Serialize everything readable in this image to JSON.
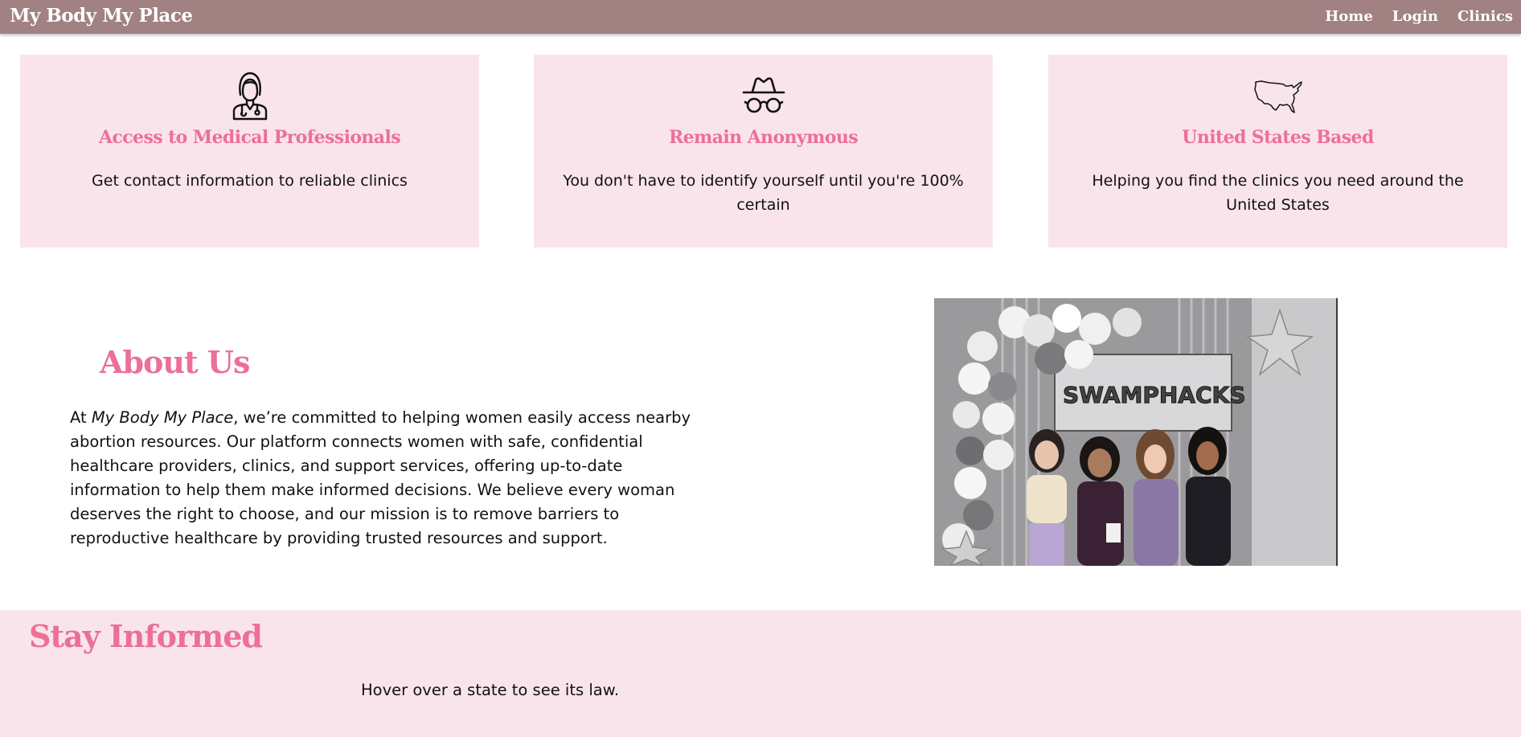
{
  "header": {
    "brand": "My Body My Place",
    "nav": [
      {
        "label": "Home"
      },
      {
        "label": "Login"
      },
      {
        "label": "Clinics"
      }
    ]
  },
  "features": [
    {
      "icon": "doctor-icon",
      "title": "Access to Medical Professionals",
      "text": "Get contact information to reliable clinics"
    },
    {
      "icon": "incognito-icon",
      "title": "Remain Anonymous",
      "text": "You don't have to identify yourself until you're 100% certain"
    },
    {
      "icon": "us-map-icon",
      "title": "United States Based",
      "text": "Helping you find the clinics you need around the United States"
    }
  ],
  "about": {
    "title": "About Us",
    "text_prefix": "At ",
    "text_emphasis": "My Body My Place",
    "text_body": ", we’re committed to helping women easily access nearby abortion resources. Our platform connects women with safe, confidential healthcare providers, clinics, and support services, offering up-to-date information to help them make informed decisions. We believe every woman deserves the right to choose, and our mission is to remove barriers to reproductive healthcare by providing trusted resources and support.",
    "photo_banner": "SWAMPHACKS"
  },
  "stay_informed": {
    "title": "Stay Informed",
    "hint": "Hover over a state to see its law."
  },
  "colors": {
    "navbar": "#a18181",
    "accent_pink": "#ec7096",
    "card_bg": "#f9e4ec"
  }
}
